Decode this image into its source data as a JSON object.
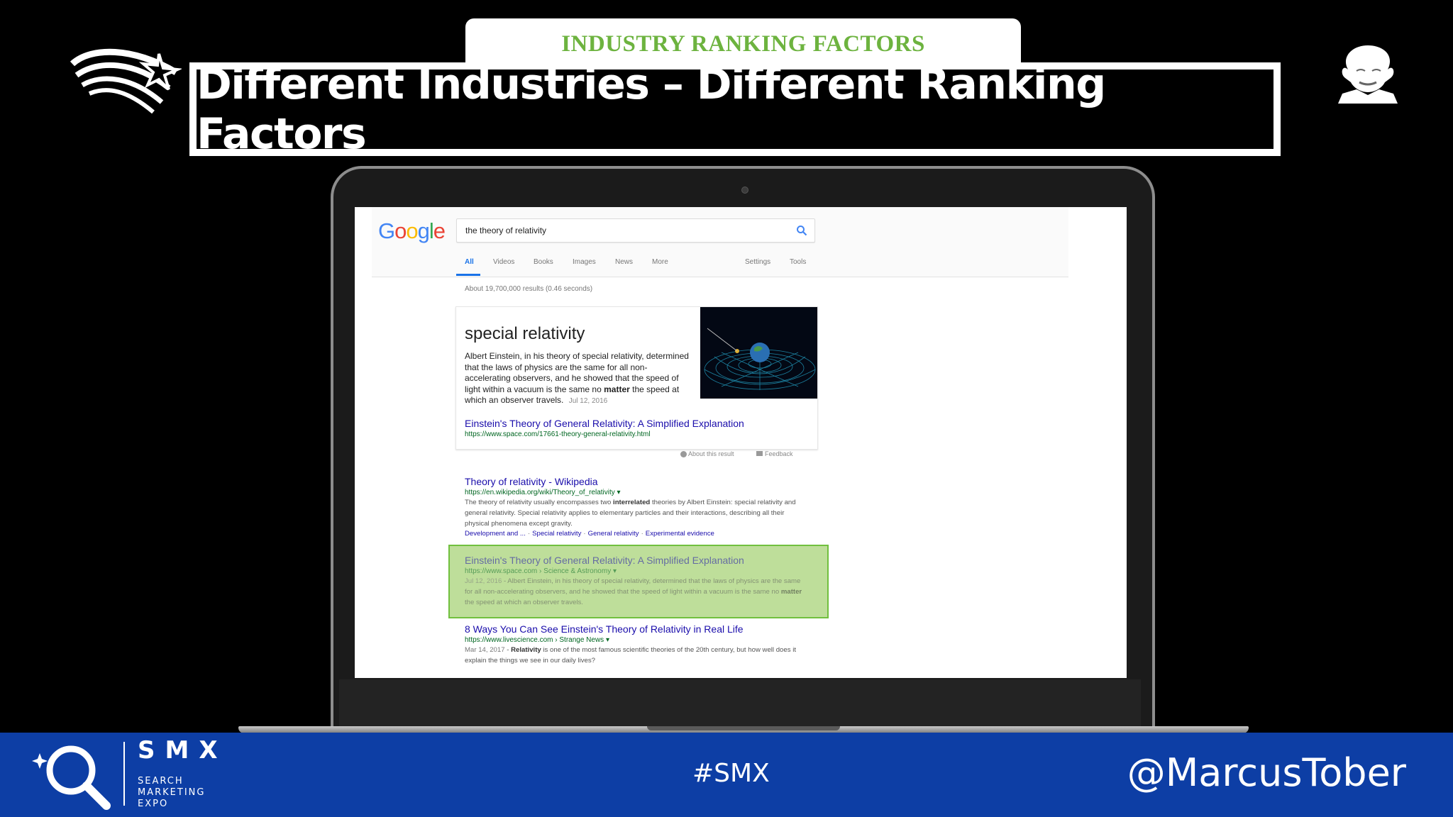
{
  "slide": {
    "kicker": "INDUSTRY RANKING FACTORS",
    "title": "Different Industries – Different Ranking Factors"
  },
  "google": {
    "logo_letters": [
      "G",
      "o",
      "o",
      "g",
      "l",
      "e"
    ],
    "logo_colors": [
      "#4285f4",
      "#ea4335",
      "#fbbc05",
      "#4285f4",
      "#34a853",
      "#ea4335"
    ],
    "search_query": "the theory of relativity",
    "tabs": [
      "All",
      "Videos",
      "Books",
      "Images",
      "News",
      "More"
    ],
    "tools": [
      "Settings",
      "Tools"
    ],
    "result_stats": "About 19,700,000 results (0.46 seconds)",
    "featured_snippet": {
      "heading": "special relativity",
      "text_before": "Albert Einstein, in his theory of special relativity, determined that the laws of physics are the same for all non-accelerating observers, and he showed that the speed of light within a vacuum is the same no ",
      "keyword": "matter",
      "text_after": " the speed at which an observer travels.",
      "date": "Jul 12, 2016",
      "link_title": "Einstein's Theory of General Relativity: A Simplified Explanation",
      "link_url": "https://www.space.com/17661-theory-general-relativity.html",
      "about": "About this result",
      "feedback": "Feedback"
    },
    "results": [
      {
        "title": "Theory of relativity - Wikipedia",
        "url": "https://en.wikipedia.org/wiki/Theory_of_relativity",
        "desc_a": "The theory of relativity usually encompasses two ",
        "desc_kw": "interrelated",
        "desc_b": " theories by Albert Einstein: special relativity and general relativity. Special relativity applies to elementary particles and their interactions, describing all their physical phenomena except gravity.",
        "sitelinks": [
          "Development and ...",
          "Special relativity",
          "General relativity",
          "Experimental evidence"
        ]
      },
      {
        "title": "Einstein's Theory of General Relativity: A Simplified Explanation",
        "url": "https://www.space.com › Science & Astronomy",
        "date": "Jul 12, 2016",
        "desc_a": " - Albert Einstein, in his theory of special relativity, determined that the laws of physics are the same for all non-accelerating observers, and he showed that the speed of light within a vacuum is the same no ",
        "desc_kw": "matter",
        "desc_b": " the speed at which an observer travels.",
        "highlighted": true
      },
      {
        "title": "8 Ways You Can See Einstein's Theory of Relativity in Real Life",
        "url": "https://www.livescience.com › Strange News",
        "date": "Mar 14, 2017",
        "desc_a": " - ",
        "desc_kw": "Relativity",
        "desc_b": " is one of the most famous scientific theories of the 20th century, but how well does it explain the things we see in our daily lives?"
      }
    ]
  },
  "footer": {
    "brand": "SMX",
    "brand_sub": "SEARCH MARKETING EXPO",
    "hashtag": "#SMX",
    "handle": "@MarcusTober",
    "bg_color": "#0d3ea5"
  },
  "icons": [
    "comet-logo-icon",
    "einstein-portrait-icon",
    "search-icon",
    "magnifier-logo-icon"
  ]
}
